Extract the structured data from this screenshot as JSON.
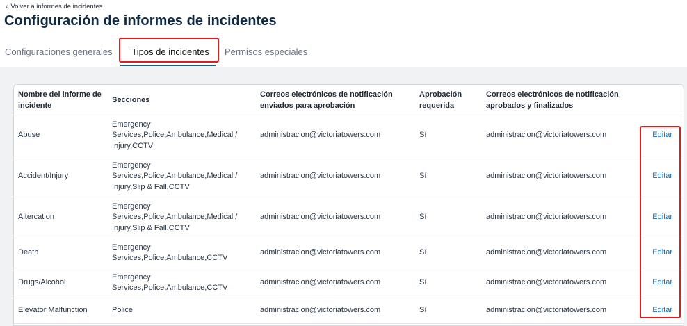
{
  "header": {
    "back_link": "Volver a informes de incidentes",
    "title": "Configuración de informes de incidentes"
  },
  "tabs": [
    {
      "label": "Configuraciones generales",
      "active": false
    },
    {
      "label": "Tipos de incidentes",
      "active": true
    },
    {
      "label": "Permisos especiales",
      "active": false
    }
  ],
  "table": {
    "columns": [
      "Nombre del informe de incidente",
      "Secciones",
      "Correos electrónicos de notificación enviados para aprobación",
      "Aprobación requerida",
      "Correos electrónicos de notificación aprobados y finalizados"
    ],
    "rows": [
      {
        "name": "Abuse",
        "sections": "Emergency Services,Police,Ambulance,Medical / Injury,CCTV",
        "approval_emails": "administracion@victoriatowers.com",
        "approval_required": "Sí",
        "final_emails": "administracion@victoriatowers.com",
        "action": "Editar"
      },
      {
        "name": "Accident/Injury",
        "sections": "Emergency Services,Police,Ambulance,Medical / Injury,Slip & Fall,CCTV",
        "approval_emails": "administracion@victoriatowers.com",
        "approval_required": "Sí",
        "final_emails": "administracion@victoriatowers.com",
        "action": "Editar"
      },
      {
        "name": "Altercation",
        "sections": "Emergency Services,Police,Ambulance,Medical / Injury,Slip & Fall,CCTV",
        "approval_emails": "administracion@victoriatowers.com",
        "approval_required": "Sí",
        "final_emails": "administracion@victoriatowers.com",
        "action": "Editar"
      },
      {
        "name": "Death",
        "sections": "Emergency Services,Police,Ambulance,CCTV",
        "approval_emails": "administracion@victoriatowers.com",
        "approval_required": "Sí",
        "final_emails": "administracion@victoriatowers.com",
        "action": "Editar"
      },
      {
        "name": "Drugs/Alcohol",
        "sections": "Emergency Services,Police,Ambulance,CCTV",
        "approval_emails": "administracion@victoriatowers.com",
        "approval_required": "Sí",
        "final_emails": "administracion@victoriatowers.com",
        "action": "Editar"
      },
      {
        "name": "Elevator Malfunction",
        "sections": "Police",
        "approval_emails": "administracion@victoriatowers.com",
        "approval_required": "Sí",
        "final_emails": "administracion@victoriatowers.com",
        "action": "Editar"
      }
    ]
  },
  "colors": {
    "title": "#0f2a44",
    "link": "#1a6aa8",
    "highlight": "#e31b1b",
    "tab_underline": "#1e5a8a"
  }
}
